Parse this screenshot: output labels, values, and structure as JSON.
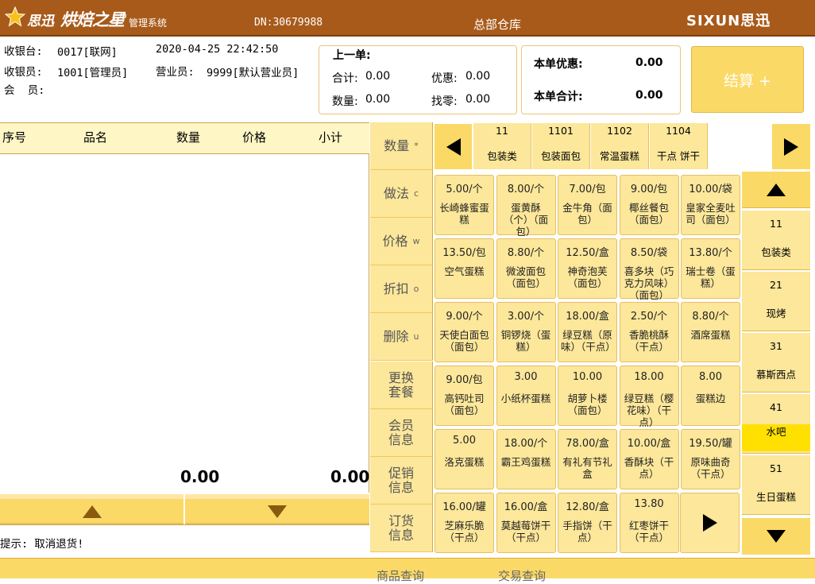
{
  "title_bar": {
    "logo_sixun": "思迅",
    "logo_product": "烘焙之星",
    "logo_sub": "管理系统",
    "dn": "DN:30679988",
    "warehouse": "总部仓库",
    "brand": "SIXUN思迅"
  },
  "info": {
    "register_label": "收银台:",
    "register_value": "0017[联网]",
    "datetime": "2020-04-25 22:42:50",
    "cashier_label": "收银员:",
    "cashier_value": "1001[管理员]",
    "sales_label": "营业员:",
    "sales_value": "9999[默认营业员]",
    "member_label": "会  员:"
  },
  "last_order": {
    "title": "上一单:",
    "total_label": "合计:",
    "total_value": "0.00",
    "discount_label": "优惠:",
    "discount_value": "0.00",
    "qty_label": "数量:",
    "qty_value": "0.00",
    "change_label": "找零:",
    "change_value": "0.00"
  },
  "current_order": {
    "discount_label": "本单优惠:",
    "discount_value": "0.00",
    "total_label": "本单合计:",
    "total_value": "0.00"
  },
  "checkout_label": "结算 +",
  "cart": {
    "columns": [
      "序号",
      "品名",
      "数量",
      "价格",
      "小计"
    ],
    "qty_total": "0.00",
    "sum_total": "0.00",
    "tip": "提示: 取消退货!"
  },
  "functions": [
    {
      "label": "数量",
      "key": "*"
    },
    {
      "label": "做法",
      "key": "c"
    },
    {
      "label": "价格",
      "key": "w"
    },
    {
      "label": "折扣",
      "key": "o"
    },
    {
      "label": "删除",
      "key": "u"
    },
    {
      "label": "更换\n套餐",
      "key": ""
    },
    {
      "label": "会员\n信息",
      "key": ""
    },
    {
      "label": "促销\n信息",
      "key": ""
    },
    {
      "label": "订货\n信息",
      "key": ""
    }
  ],
  "category_tabs": [
    {
      "code": "11",
      "name": "包装类"
    },
    {
      "code": "1101",
      "name": "包装面包"
    },
    {
      "code": "1102",
      "name": "常温蛋糕"
    },
    {
      "code": "1104",
      "name": "干点 饼干"
    }
  ],
  "products": [
    {
      "price": "5.00/个",
      "name": "长崎蜂蜜蛋糕"
    },
    {
      "price": "8.00/个",
      "name": "蛋黄酥（个）（面包）"
    },
    {
      "price": "7.00/包",
      "name": "金牛角（面包）"
    },
    {
      "price": "9.00/包",
      "name": "椰丝餐包（面包）"
    },
    {
      "price": "10.00/袋",
      "name": "皇家全麦吐司（面包）"
    },
    {
      "price": "13.50/包",
      "name": "空气蛋糕"
    },
    {
      "price": "8.80/个",
      "name": "微波面包（面包）"
    },
    {
      "price": "12.50/盒",
      "name": "神奇泡芙（面包）"
    },
    {
      "price": "8.50/袋",
      "name": "喜多块（巧克力风味）（面包）"
    },
    {
      "price": "13.80/个",
      "name": "瑞士卷（蛋糕）"
    },
    {
      "price": "9.00/个",
      "name": "天使白面包（面包）"
    },
    {
      "price": "3.00/个",
      "name": "铜锣烧（蛋糕）"
    },
    {
      "price": "18.00/盒",
      "name": "绿豆糕（原味）（干点）"
    },
    {
      "price": "2.50/个",
      "name": "香脆桃酥（干点）"
    },
    {
      "price": "8.80/个",
      "name": "酒席蛋糕"
    },
    {
      "price": "9.00/包",
      "name": "高钙吐司（面包）"
    },
    {
      "price": "3.00",
      "name": "小纸杯蛋糕"
    },
    {
      "price": "10.00",
      "name": "胡萝卜楼（面包）"
    },
    {
      "price": "18.00",
      "name": "绿豆糕（樱花味）（干点）"
    },
    {
      "price": "8.00",
      "name": "蛋糕边"
    },
    {
      "price": "5.00",
      "name": "洛克蛋糕"
    },
    {
      "price": "18.00/个",
      "name": "霸王鸡蛋糕"
    },
    {
      "price": "78.00/盒",
      "name": "有礼有节礼盒"
    },
    {
      "price": "10.00/盒",
      "name": "香酥块（干点）"
    },
    {
      "price": "19.50/罐",
      "name": "原味曲奇（干点）"
    },
    {
      "price": "16.00/罐",
      "name": "芝麻乐脆（干点）"
    },
    {
      "price": "16.00/盒",
      "name": "莫越莓饼干（干点）"
    },
    {
      "price": "12.80/盒",
      "name": "手指饼（干点）"
    },
    {
      "price": "13.80",
      "name": "红枣饼干（干点）"
    }
  ],
  "right_categories": [
    {
      "code": "11",
      "name": "包装类",
      "selected": false
    },
    {
      "code": "21",
      "name": "现烤",
      "selected": false
    },
    {
      "code": "31",
      "name": "慕斯西点",
      "selected": false
    },
    {
      "code": "41",
      "name": "水吧",
      "selected": true
    },
    {
      "code": "51",
      "name": "生日蛋糕",
      "selected": false
    }
  ],
  "bottom": {
    "product_query": "商品查询",
    "trade_query": "交易查询"
  },
  "colors": {
    "title_bg": "#a85a1a",
    "button_bg": "#fce79a",
    "accent": "#fbd966",
    "selected": "#ffe000"
  }
}
